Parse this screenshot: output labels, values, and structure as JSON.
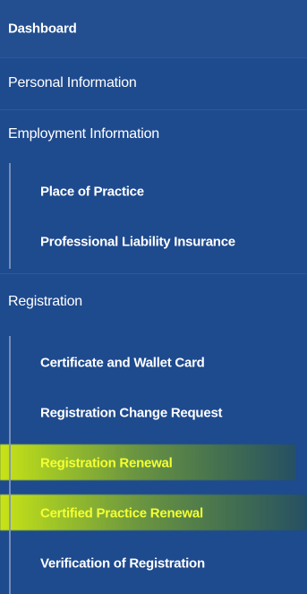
{
  "sidebar": {
    "dashboard": "Dashboard",
    "personal_information": "Personal Information",
    "employment_information": {
      "label": "Employment Information",
      "items": [
        {
          "label": "Place of Practice"
        },
        {
          "label": "Professional Liability Insurance"
        }
      ]
    },
    "registration": {
      "label": "Registration",
      "items": [
        {
          "label": "Certificate and Wallet Card"
        },
        {
          "label": "Registration Change Request"
        },
        {
          "label": "Registration Renewal"
        },
        {
          "label": "Certified Practice Renewal"
        },
        {
          "label": "Verification of Registration"
        }
      ]
    }
  },
  "colors": {
    "background": "#1e4a8e",
    "text": "#ffffff",
    "highlight": "#e7ff00",
    "highlight_text": "#f4ff33"
  }
}
